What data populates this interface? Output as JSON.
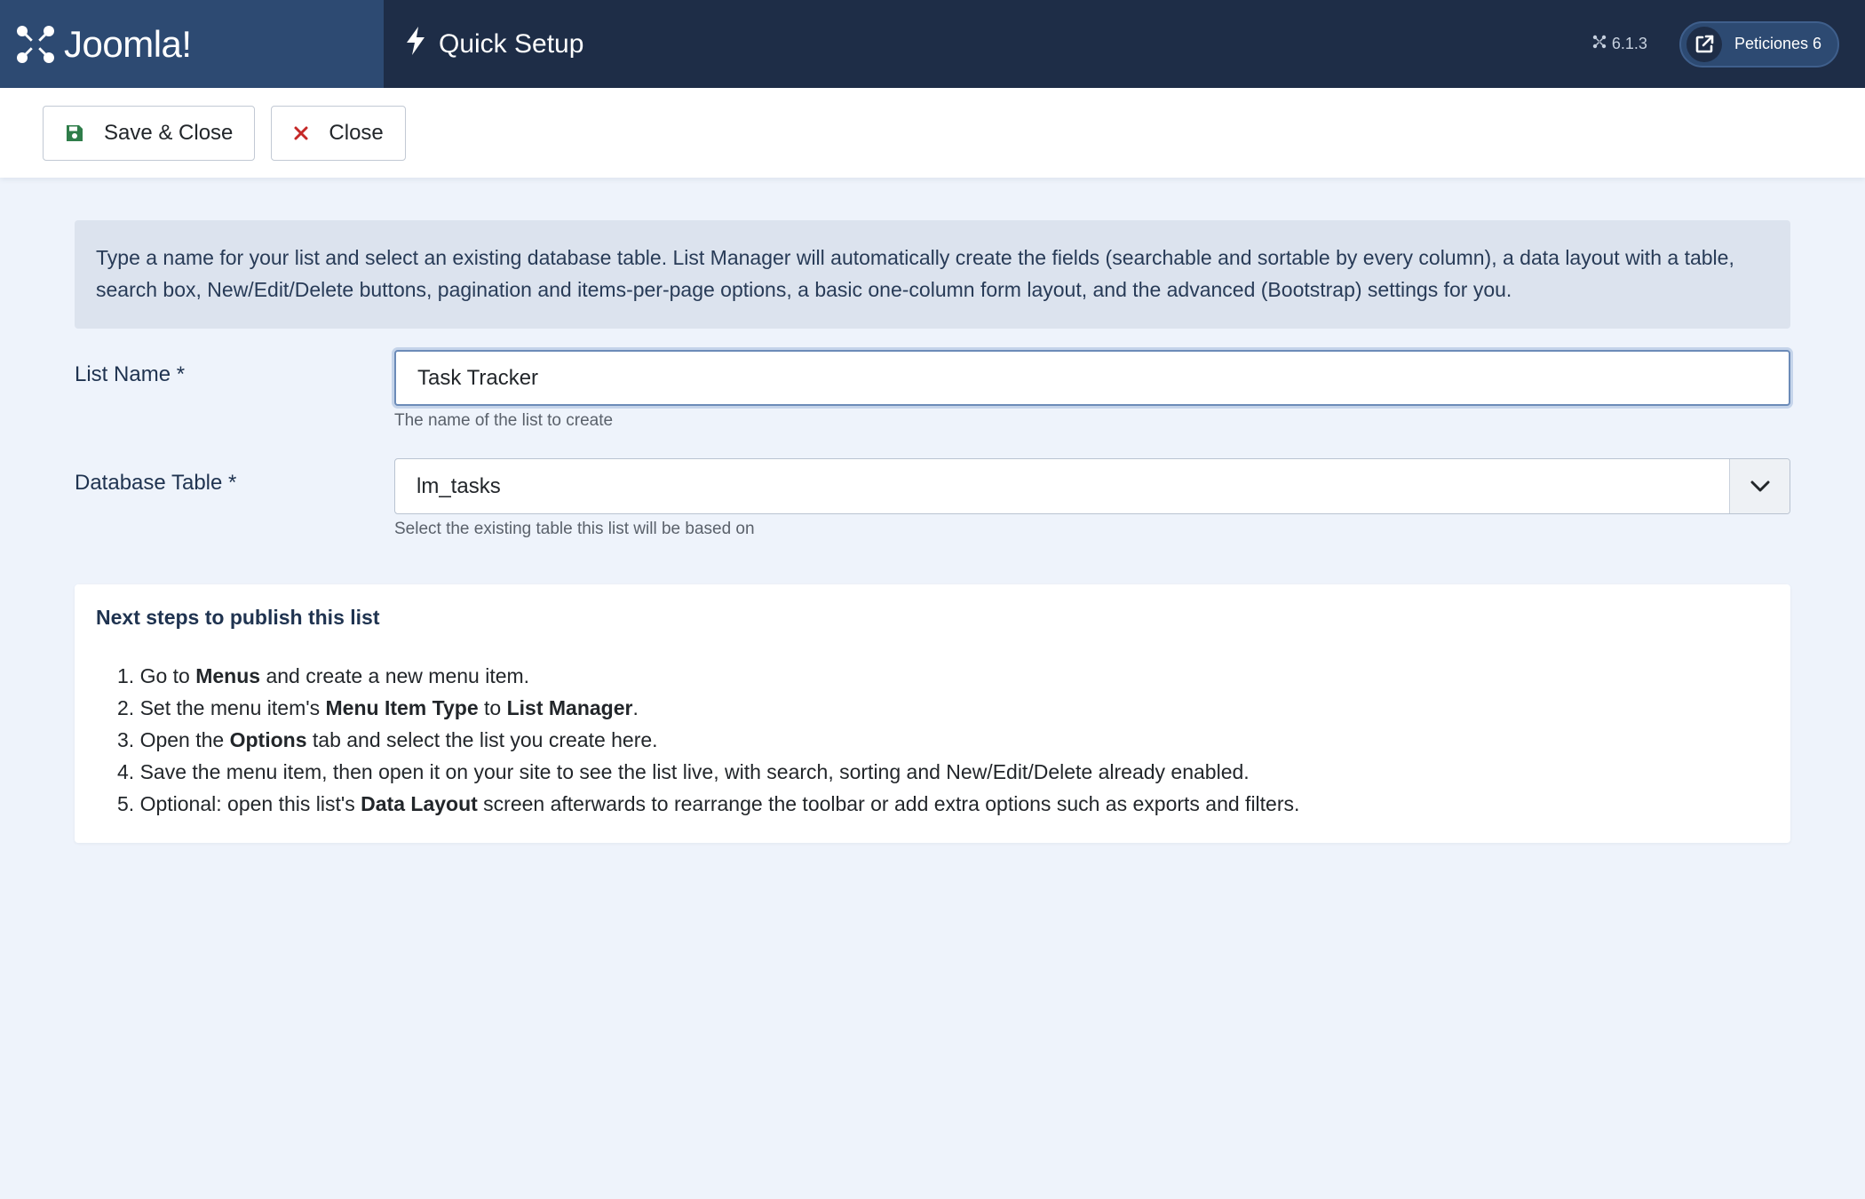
{
  "app": {
    "logo_text": "Joomla!",
    "title": "Quick Setup",
    "version": "6.1.3",
    "requests_label": "Peticiones 6"
  },
  "toolbar": {
    "save_close_label": "Save & Close",
    "close_label": "Close"
  },
  "info": {
    "text": "Type a name for your list and select an existing database table. List Manager will automatically create the fields (searchable and sortable by every column), a data layout with a table, search box, New/Edit/Delete buttons, pagination and items-per-page options, a basic one-column form layout, and the advanced (Bootstrap) settings for you."
  },
  "form": {
    "list_name": {
      "label": "List Name *",
      "value": "Task Tracker",
      "help": "The name of the list to create"
    },
    "database_table": {
      "label": "Database Table *",
      "selected": "lm_tasks",
      "help": "Select the existing table this list will be based on"
    }
  },
  "steps": {
    "title": "Next steps to publish this list",
    "items": [
      {
        "n": "1.",
        "parts": [
          {
            "t": "Go to "
          },
          {
            "t": "Menus",
            "b": true
          },
          {
            "t": " and create a new menu item."
          }
        ]
      },
      {
        "n": "2.",
        "parts": [
          {
            "t": "Set the menu item's "
          },
          {
            "t": "Menu Item Type",
            "b": true
          },
          {
            "t": " to "
          },
          {
            "t": "List Manager",
            "b": true
          },
          {
            "t": "."
          }
        ]
      },
      {
        "n": "3.",
        "parts": [
          {
            "t": "Open the "
          },
          {
            "t": "Options",
            "b": true
          },
          {
            "t": " tab and select the list you create here."
          }
        ]
      },
      {
        "n": "4.",
        "parts": [
          {
            "t": "Save the menu item, then open it on your site to see the list live, with search, sorting and New/Edit/Delete already enabled."
          }
        ]
      },
      {
        "n": "5.",
        "parts": [
          {
            "t": "Optional: open this list's "
          },
          {
            "t": "Data Layout",
            "b": true
          },
          {
            "t": " screen afterwards to rearrange the toolbar or add extra options such as exports and filters."
          }
        ]
      }
    ]
  },
  "colors": {
    "header_bg": "#1e2d47",
    "logo_bg": "#2d4a72",
    "save_icon": "#2f7d4a",
    "close_icon": "#c52827"
  },
  "icons": {
    "logo": "joomla-logo-icon",
    "title": "lightning-bolt-icon",
    "version": "joomla-small-icon",
    "requests": "external-link-icon",
    "save": "floppy-disk-icon",
    "close": "close-x-icon",
    "select": "chevron-down-icon"
  }
}
